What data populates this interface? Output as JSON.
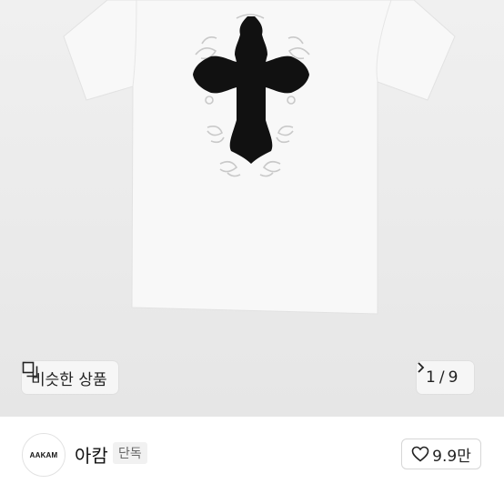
{
  "product": {
    "image_alt": "white t-shirt with black cross patch",
    "shirt_color": "#f7f7f7",
    "cross_color": "#111111",
    "similar_button": {
      "icon": "similar-items-icon",
      "label": "비슷한 상품"
    },
    "pager": {
      "current": "1",
      "separator": "/",
      "total": "9",
      "icon": "chevron-right-icon"
    }
  },
  "shop": {
    "logo_text": "AAKAM",
    "name": "아캄",
    "badge": "단독",
    "likes": {
      "icon": "heart-outline-icon",
      "count": "9.9만"
    }
  }
}
